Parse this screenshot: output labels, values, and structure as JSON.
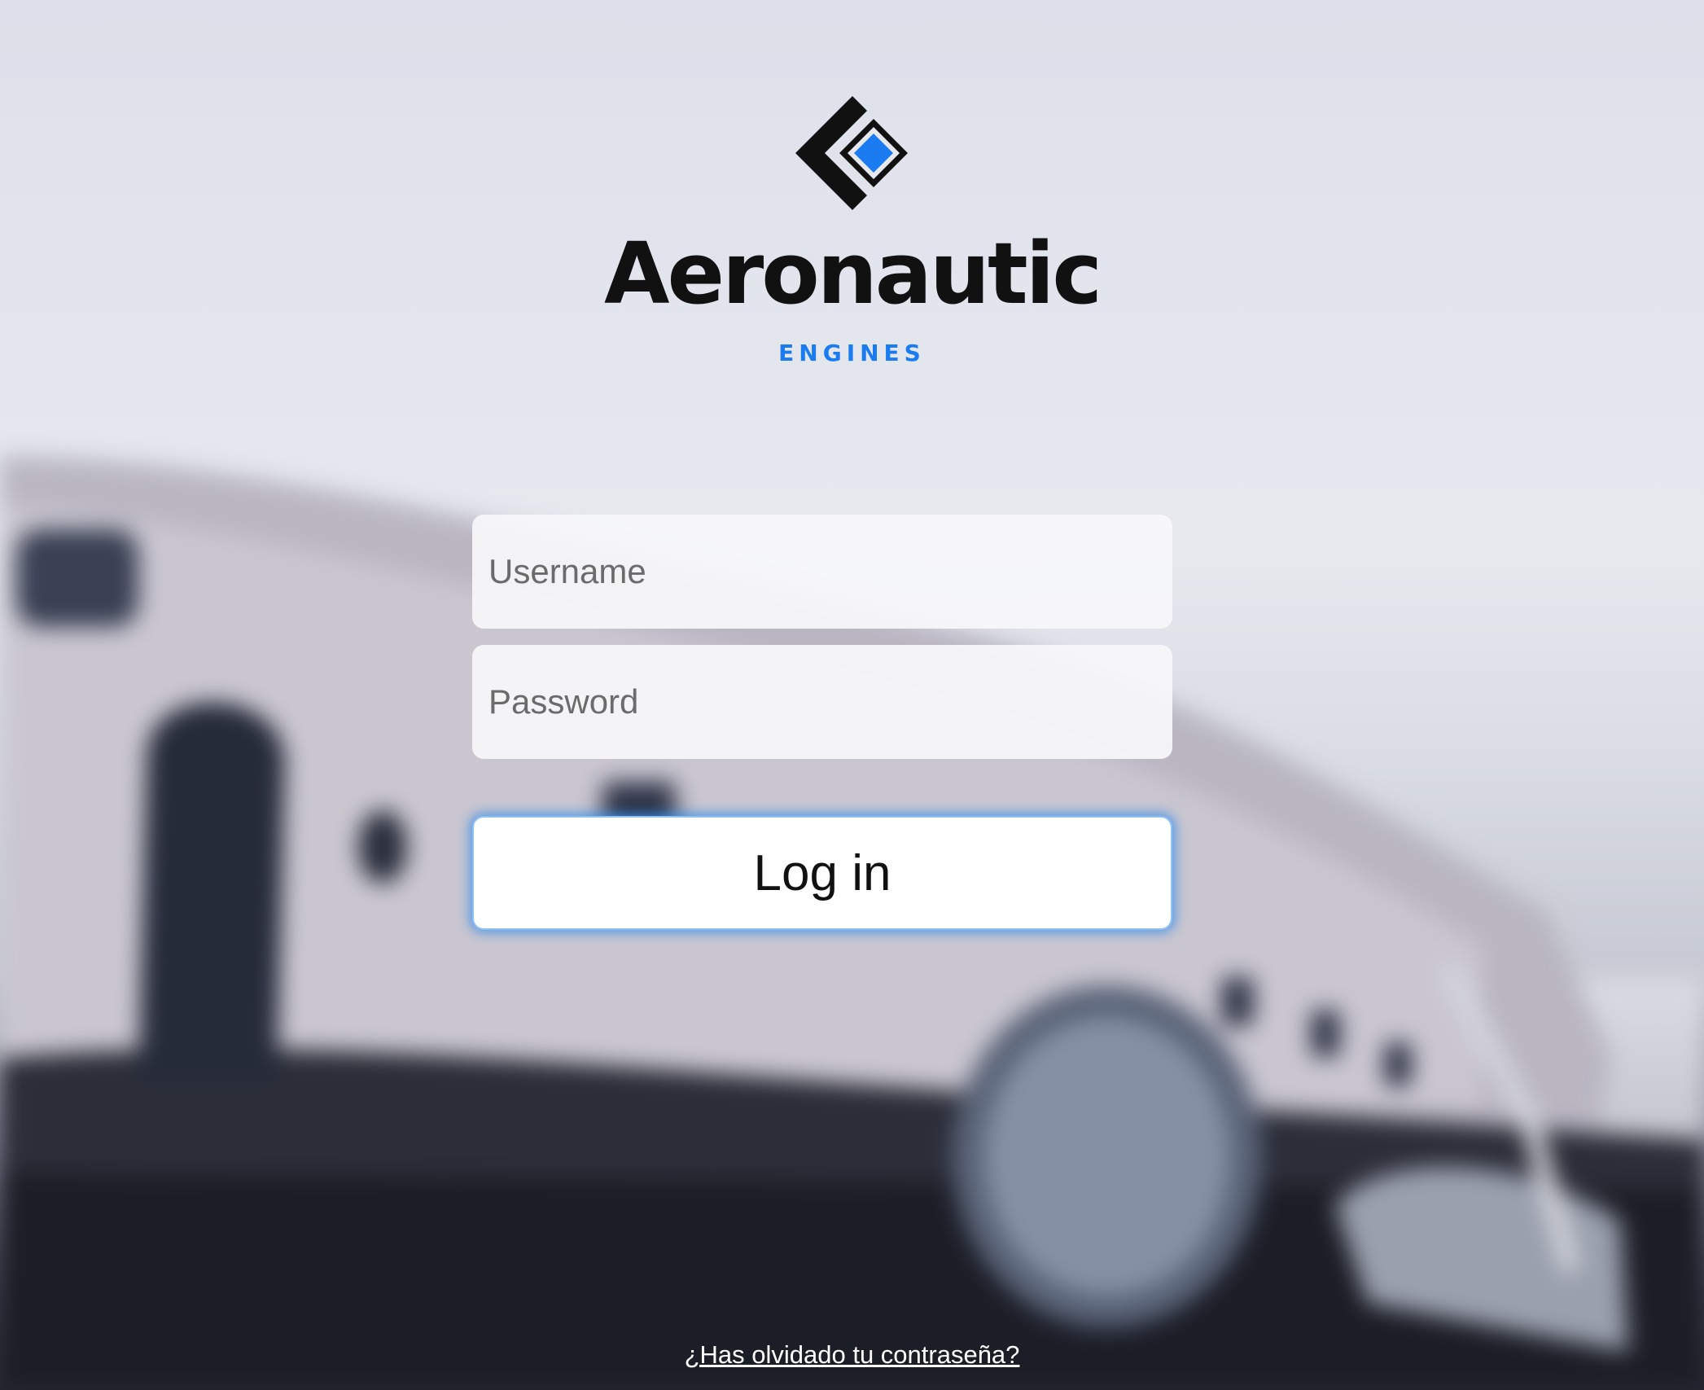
{
  "brand": {
    "name": "Aeronautic",
    "tagline": "ENGINES",
    "logo_icon": "diamond-chevron-logo",
    "accent_color": "#1a7cf0"
  },
  "login": {
    "username_placeholder": "Username",
    "username_value": "",
    "password_placeholder": "Password",
    "password_value": "",
    "submit_label": "Log in",
    "forgot_password_label": "¿Has olvidado tu contraseña?"
  },
  "background": {
    "description_icon": "blurred-plane-wreck-photo"
  }
}
